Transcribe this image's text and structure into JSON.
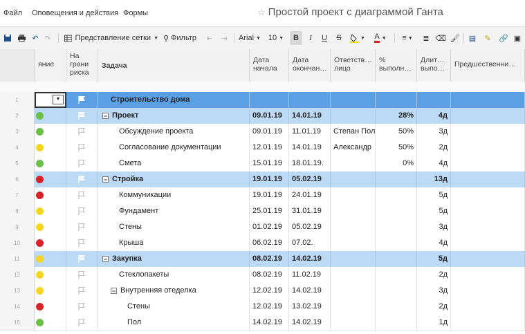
{
  "menu": {
    "file": "Файл",
    "alerts": "Оповещения и действия",
    "forms": "Формы"
  },
  "title": "Простой проект с диаграммой Ганта",
  "toolbar": {
    "grid_view": "Представление сетки",
    "filter": "Фильтр",
    "font": "Arial",
    "size": "10",
    "bold": "B",
    "italic": "I",
    "underline": "U",
    "strike": "S",
    "text_color": "A"
  },
  "columns": {
    "status": "яние",
    "at_risk": "На грани риска",
    "task": "Задача",
    "start": "Дата начала",
    "end": "Дата окончан…",
    "owner": "Ответств… лицо",
    "percent": "% выполн…",
    "duration": "Длит… выпо…",
    "predecessors": "Предшественни…"
  },
  "colors": {
    "green": "#6cc04a",
    "yellow": "#f5d623",
    "red": "#d8232a",
    "summary_blue": "#5ba0e5",
    "group_blue": "#bcd9f5"
  },
  "rows": [
    {
      "n": "1",
      "level": 0,
      "status": "",
      "task": "Строительство дома",
      "start": "",
      "end": "",
      "owner": "",
      "percent": "",
      "duration": "",
      "toggle": ""
    },
    {
      "n": "2",
      "level": 1,
      "status": "green",
      "task": "Проект",
      "start": "09.01.19",
      "end": "14.01.19",
      "owner": "",
      "percent": "28%",
      "duration": "4д",
      "toggle": "−"
    },
    {
      "n": "3",
      "level": 2,
      "status": "green",
      "task": "Обсуждение проекта",
      "start": "09.01.19",
      "end": "11.01.19",
      "owner": "Степан Пол",
      "percent": "50%",
      "duration": "3д",
      "toggle": ""
    },
    {
      "n": "4",
      "level": 2,
      "status": "yellow",
      "task": "Согласование документации",
      "start": "12.01.19",
      "end": "14.01.19",
      "owner": "Александр",
      "percent": "50%",
      "duration": "2д",
      "toggle": ""
    },
    {
      "n": "5",
      "level": 2,
      "status": "green",
      "task": "Смета",
      "start": "15.01.19",
      "end": "18.01.19.",
      "owner": "",
      "percent": "0%",
      "duration": "4д",
      "toggle": ""
    },
    {
      "n": "6",
      "level": 1,
      "status": "red",
      "task": "Стройка",
      "start": "19.01.19",
      "end": "05.02.19",
      "owner": "",
      "percent": "",
      "duration": "13д",
      "toggle": "−"
    },
    {
      "n": "7",
      "level": 2,
      "status": "red",
      "task": "Коммуникации",
      "start": "19.01.19",
      "end": "24.01.19",
      "owner": "",
      "percent": "",
      "duration": "5д",
      "toggle": ""
    },
    {
      "n": "8",
      "level": 2,
      "status": "yellow",
      "task": "Фундамент",
      "start": "25.01.19",
      "end": "31.01.19",
      "owner": "",
      "percent": "",
      "duration": "5д",
      "toggle": ""
    },
    {
      "n": "9",
      "level": 2,
      "status": "yellow",
      "task": "Стены",
      "start": "01.02.19",
      "end": "05.02.19",
      "owner": "",
      "percent": "",
      "duration": "3д",
      "toggle": ""
    },
    {
      "n": "10",
      "level": 2,
      "status": "red",
      "task": "Крыша",
      "start": "06.02.19",
      "end": "07.02.",
      "owner": "",
      "percent": "",
      "duration": "4д",
      "toggle": ""
    },
    {
      "n": "11",
      "level": 1,
      "status": "yellow",
      "task": "Закупка",
      "start": "08.02.19",
      "end": "14.02.19",
      "owner": "",
      "percent": "",
      "duration": "5д",
      "toggle": "−"
    },
    {
      "n": "12",
      "level": 2,
      "status": "yellow",
      "task": "Стеклопакеты",
      "start": "08.02.19",
      "end": "11.02.19",
      "owner": "",
      "percent": "",
      "duration": "2д",
      "toggle": ""
    },
    {
      "n": "13",
      "level": 2,
      "status": "yellow",
      "task": "Внутренняя отеделка",
      "start": "12.02.19",
      "end": "14.02.19",
      "owner": "",
      "percent": "",
      "duration": "3д",
      "toggle": "−"
    },
    {
      "n": "14",
      "level": 3,
      "status": "red",
      "task": "Стены",
      "start": "12.02.19",
      "end": "13.02.19",
      "owner": "",
      "percent": "",
      "duration": "2д",
      "toggle": ""
    },
    {
      "n": "15",
      "level": 3,
      "status": "green",
      "task": "Пол",
      "start": "14.02.19",
      "end": "14.02.19",
      "owner": "",
      "percent": "",
      "duration": "1д",
      "toggle": ""
    }
  ]
}
